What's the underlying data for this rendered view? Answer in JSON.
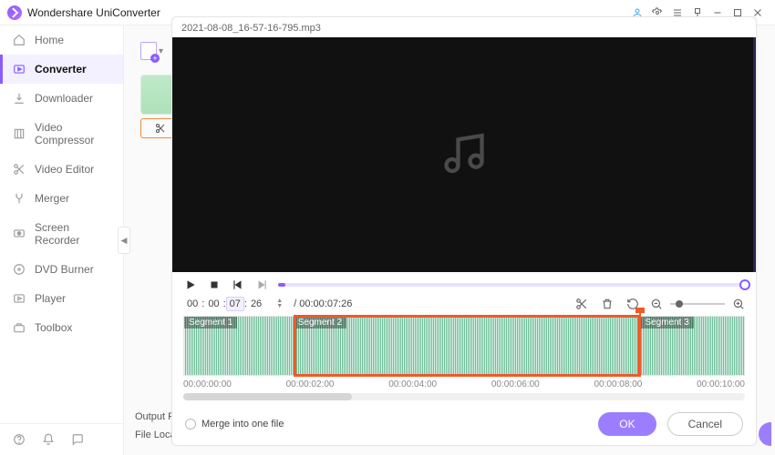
{
  "app": {
    "name": "Wondershare UniConverter"
  },
  "window_buttons": [
    "minimize",
    "maximize",
    "close"
  ],
  "sidebar": {
    "items": [
      {
        "label": "Home",
        "icon": "home-icon"
      },
      {
        "label": "Converter",
        "icon": "converter-icon",
        "active": true
      },
      {
        "label": "Downloader",
        "icon": "download-icon"
      },
      {
        "label": "Video Compressor",
        "icon": "compress-icon"
      },
      {
        "label": "Video Editor",
        "icon": "scissors-icon"
      },
      {
        "label": "Merger",
        "icon": "merge-icon"
      },
      {
        "label": "Screen Recorder",
        "icon": "record-icon"
      },
      {
        "label": "DVD Burner",
        "icon": "disc-icon"
      },
      {
        "label": "Player",
        "icon": "play-icon"
      },
      {
        "label": "Toolbox",
        "icon": "toolbox-icon"
      }
    ]
  },
  "content": {
    "output_form_label": "Output Form",
    "file_location_label": "File Location"
  },
  "editor": {
    "filename": "2021-08-08_16-57-16-795.mp3",
    "current_time_parts": [
      "00",
      "00",
      "07",
      "26"
    ],
    "total_time_label": "/ 00:00:07:26",
    "segments": [
      {
        "label": "Segment 1",
        "left_pct": 0,
        "width_pct": 19.5
      },
      {
        "label": "Segment 2",
        "left_pct": 19.5,
        "width_pct": 62,
        "selected": true
      },
      {
        "label": "Segment 3",
        "left_pct": 81.5,
        "width_pct": 18.5
      }
    ],
    "selection": {
      "left_pct": 19.5,
      "width_pct": 62
    },
    "playhead_pct": 81.2,
    "ticks": [
      "00:00:00:00",
      "00:00:02:00",
      "00:00:04:00",
      "00:00:06:00",
      "00:00:08:00",
      "00:00:10:00"
    ],
    "merge_label": "Merge into one file",
    "ok_label": "OK",
    "cancel_label": "Cancel"
  }
}
